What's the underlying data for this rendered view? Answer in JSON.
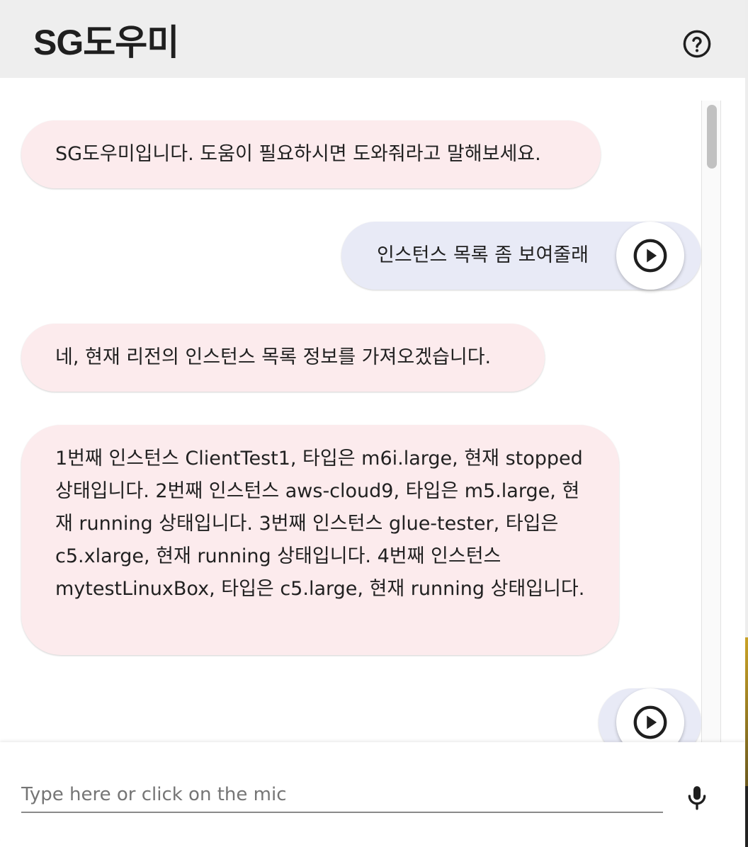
{
  "app": {
    "title": "SG도우미"
  },
  "header": {
    "help_icon": "help-circle-outline-icon"
  },
  "messages": [
    {
      "sender": "bot",
      "text": "SG도우미입니다. 도움이 필요하시면 도와줘라고 말해보세요."
    },
    {
      "sender": "user",
      "text": "인스턴스 목록 좀 보여줄래",
      "play_icon": "play-circle-outline-icon"
    },
    {
      "sender": "bot",
      "text": "네, 현재 리전의 인스턴스 목록 정보를 가져오겠습니다."
    },
    {
      "sender": "bot",
      "text": "1번째 인스턴스 ClientTest1, 타입은 m6i.large, 현재 stopped 상태입니다. 2번째 인스턴스 aws-cloud9, 타입은 m5.large, 현재 running 상태입니다. 3번째 인스턴스 glue-tester, 타입은 c5.xlarge, 현재 running 상태입니다. 4번째 인스턴스 mytestLinuxBox, 타입은 c5.large, 현재 running 상태입니다."
    },
    {
      "sender": "user",
      "text": "",
      "play_icon": "play-circle-outline-icon"
    }
  ],
  "input": {
    "placeholder": "Type here or click on the mic",
    "value": "",
    "mic_icon": "mic-icon"
  },
  "colors": {
    "header_bg": "#eeeeee",
    "bot_bubble": "#fcebed",
    "user_bubble": "#e8eaf6",
    "text": "#212121"
  }
}
